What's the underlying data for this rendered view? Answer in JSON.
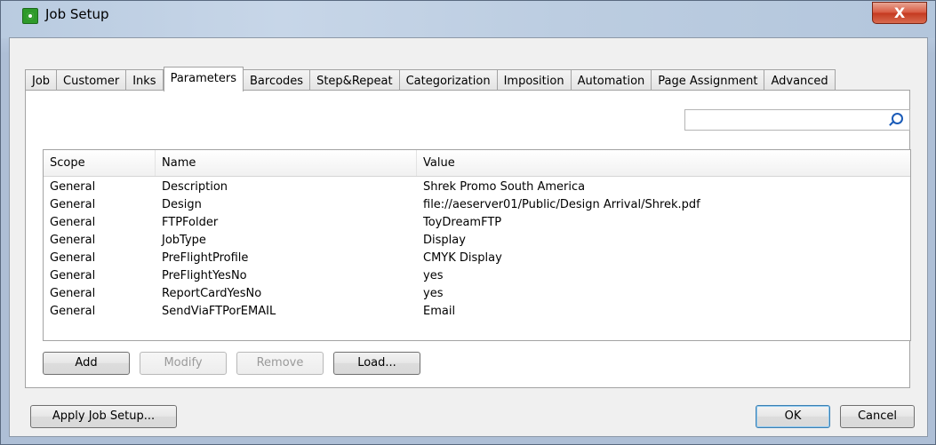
{
  "window": {
    "title": "Job Setup",
    "close_label": "X"
  },
  "tabs": [
    {
      "label": "Job"
    },
    {
      "label": "Customer"
    },
    {
      "label": "Inks"
    },
    {
      "label": "Parameters",
      "active": true
    },
    {
      "label": "Barcodes"
    },
    {
      "label": "Step&Repeat"
    },
    {
      "label": "Categorization"
    },
    {
      "label": "Imposition"
    },
    {
      "label": "Automation"
    },
    {
      "label": "Page Assignment"
    },
    {
      "label": "Advanced"
    }
  ],
  "search": {
    "value": "",
    "placeholder": ""
  },
  "table": {
    "columns": [
      "Scope",
      "Name",
      "Value"
    ],
    "rows": [
      [
        "General",
        "Description",
        "Shrek Promo South America"
      ],
      [
        "General",
        "Design",
        "file://aeserver01/Public/Design Arrival/Shrek.pdf"
      ],
      [
        "General",
        "FTPFolder",
        "ToyDreamFTP"
      ],
      [
        "General",
        "JobType",
        "Display"
      ],
      [
        "General",
        "PreFlightProfile",
        "CMYK Display"
      ],
      [
        "General",
        "PreFlightYesNo",
        "yes"
      ],
      [
        "General",
        "ReportCardYesNo",
        "yes"
      ],
      [
        "General",
        "SendViaFTPorEMAIL",
        "Email"
      ]
    ]
  },
  "panel_buttons": {
    "add": "Add",
    "modify": "Modify",
    "remove": "Remove",
    "load": "Load..."
  },
  "footer": {
    "apply": "Apply Job Setup...",
    "ok": "OK",
    "cancel": "Cancel"
  },
  "colors": {
    "accent": "#3c7fb1",
    "close": "#c4391f",
    "icon": "#2e9a2a"
  }
}
